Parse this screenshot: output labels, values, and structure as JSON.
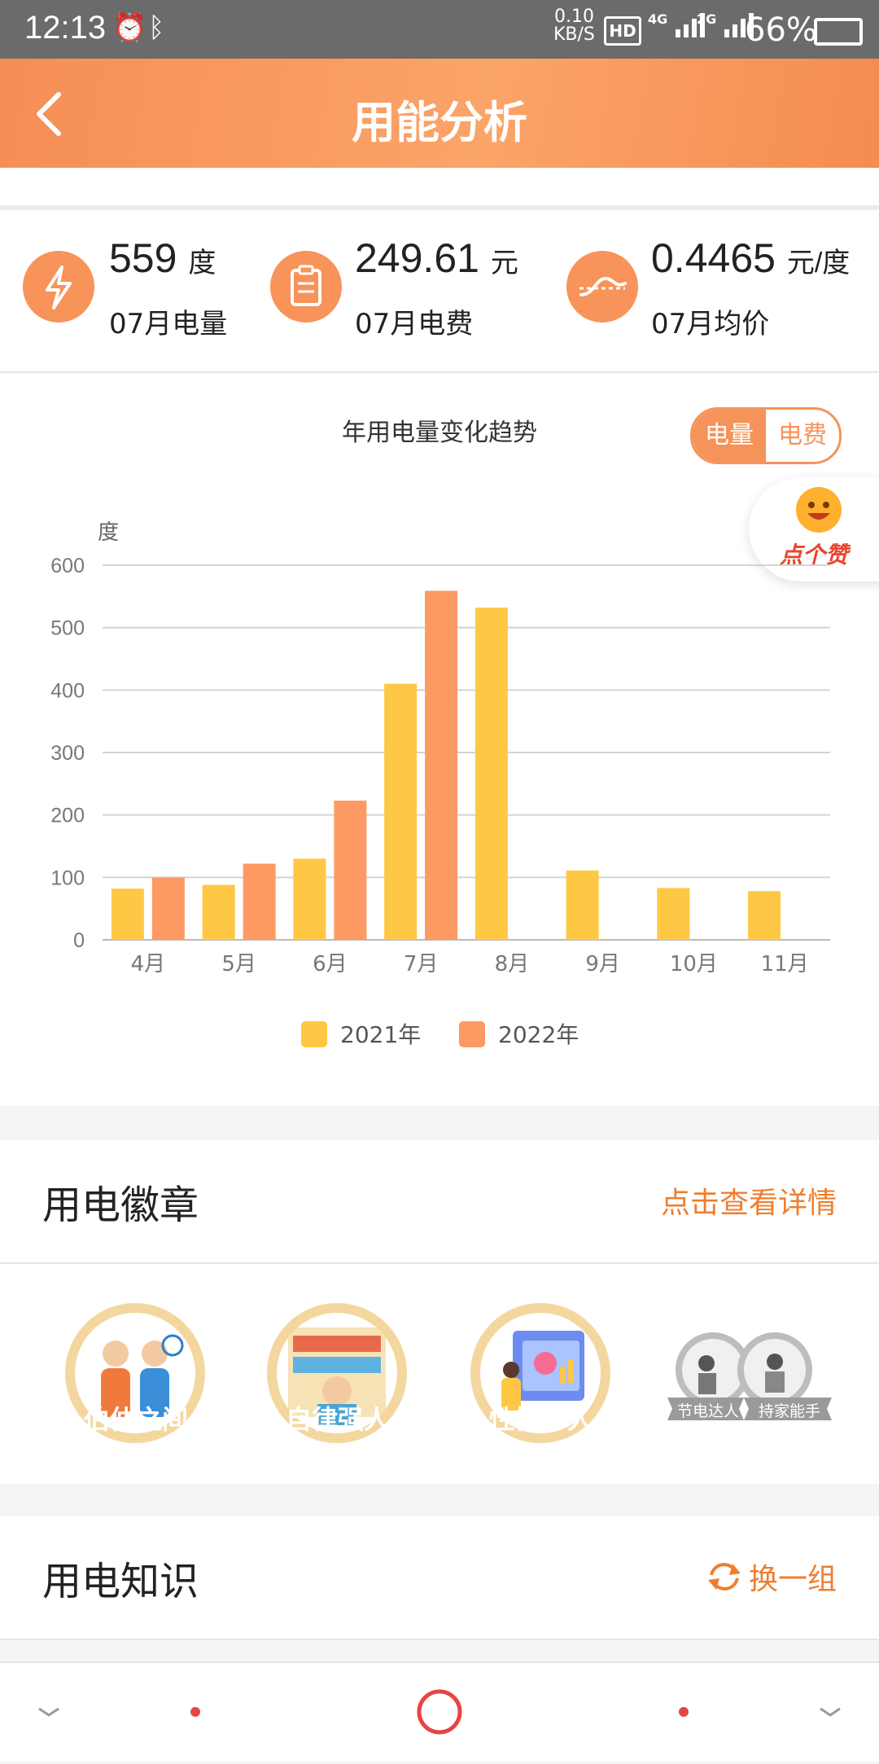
{
  "status_bar": {
    "time": "12:13",
    "net_speed": "0.10",
    "net_unit": "KB/S",
    "hd": "HD",
    "sig1": "4G",
    "sig2": "2G",
    "battery": "66%"
  },
  "header": {
    "title": "用能分析"
  },
  "stats": [
    {
      "value": "559",
      "unit": "度",
      "label": "07月电量",
      "icon": "lightning-icon"
    },
    {
      "value": "249.61",
      "unit": "元",
      "label": "07月电费",
      "icon": "bill-icon"
    },
    {
      "value": "0.4465",
      "unit": "元/度",
      "label": "07月均价",
      "icon": "trend-icon"
    }
  ],
  "chart": {
    "title": "年用电量变化趋势",
    "toggle": {
      "active": "电量",
      "inactive": "电费"
    },
    "like_label": "点个赞",
    "colors": {
      "s2021": "#ffc844",
      "s2022": "#fd9a63"
    }
  },
  "chart_data": {
    "type": "bar",
    "ylabel": "度",
    "ylim": [
      0,
      600
    ],
    "yticks": [
      "0",
      "100",
      "200",
      "300",
      "400",
      "500",
      "600"
    ],
    "categories": [
      "4月",
      "5月",
      "6月",
      "7月",
      "8月",
      "9月",
      "10月",
      "11月"
    ],
    "series": [
      {
        "name": "2021年",
        "values": [
          82,
          88,
          130,
          410,
          532,
          111,
          83,
          78
        ]
      },
      {
        "name": "2022年",
        "values": [
          100,
          122,
          223,
          559,
          null,
          null,
          null,
          null
        ]
      }
    ]
  },
  "badges_section": {
    "title": "用电徽章",
    "link": "点击查看详情"
  },
  "badges": [
    {
      "label": "伯仲之间",
      "color": "#3fb3cd"
    },
    {
      "label": "自律强人",
      "color": "#9fc02a"
    },
    {
      "label": "性情中人",
      "color": "#22c3c9"
    }
  ],
  "grey_badges": {
    "a": "节电达人",
    "b": "持家能手"
  },
  "knowledge_section": {
    "title": "用电知识",
    "link": "换一组"
  }
}
